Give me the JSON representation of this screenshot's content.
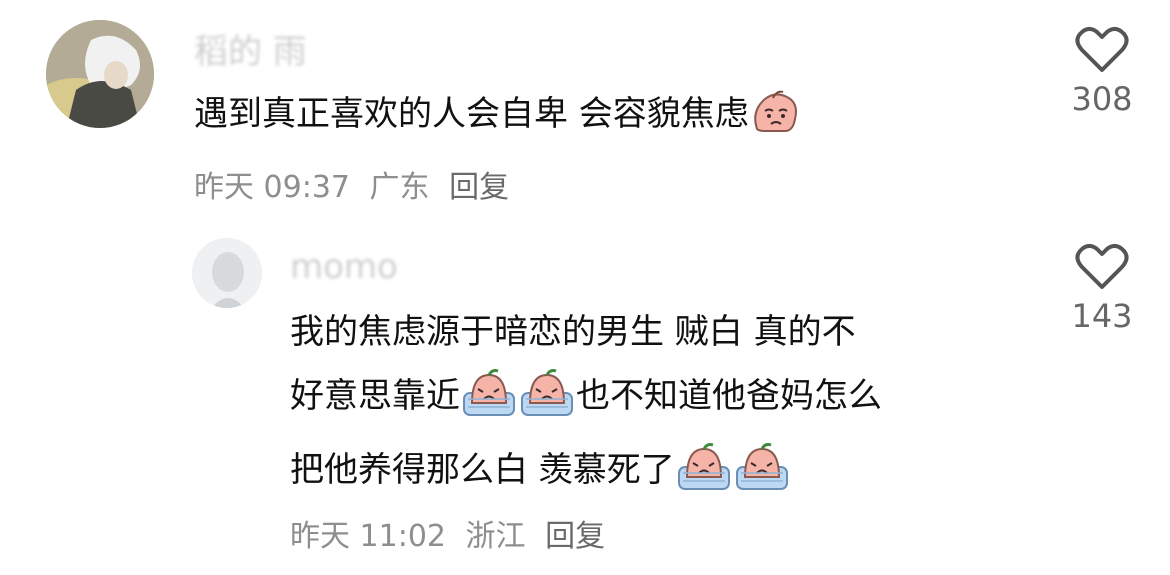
{
  "comments": [
    {
      "username": "稻的 雨",
      "text_parts": [
        "遇到真正喜欢的人会自卑 会容貌焦虑"
      ],
      "time": "昨天 09:37",
      "location": "广东",
      "reply_label": "回复",
      "likes": "308"
    },
    {
      "username": "momo",
      "text_line1": "我的焦虑源于暗恋的男生 贼白 真的不",
      "text_line2a": "好意思靠近",
      "text_line2b": "也不知道他爸妈怎么",
      "text_line3": "把他养得那么白 羡慕死了",
      "time": "昨天 11:02",
      "location": "浙江",
      "reply_label": "回复",
      "likes": "143"
    }
  ],
  "colors": {
    "text": "#111111",
    "meta": "#8e8e8e",
    "heart": "#555555"
  },
  "icons": [
    "heart-outline-icon",
    "worried-face-emoji",
    "crying-face-emoji"
  ]
}
